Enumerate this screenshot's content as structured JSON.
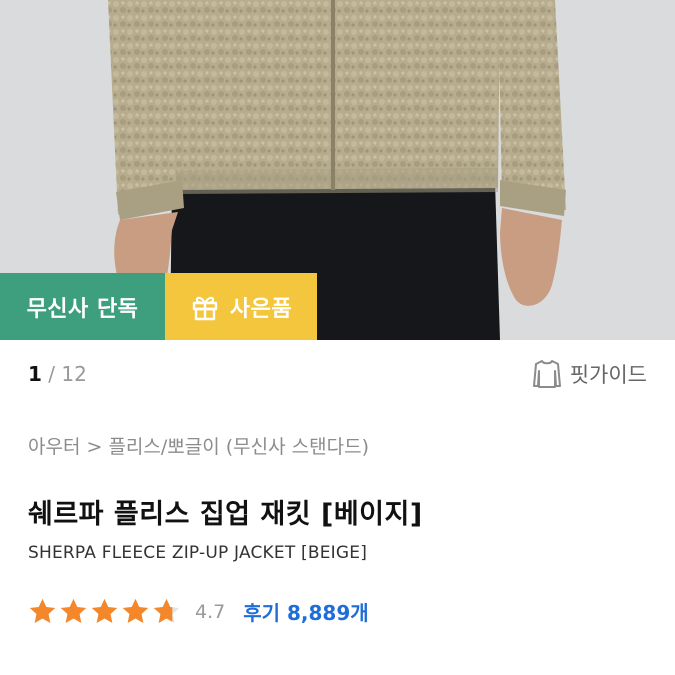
{
  "badges": {
    "exclusive": "무신사 단독",
    "gift": "사은품",
    "gift_icon": "gift-icon",
    "exclusive_color": "#3d9f7e",
    "gift_color": "#f4c63d"
  },
  "pager": {
    "current": "1",
    "separator": " / ",
    "total": "12"
  },
  "fit_guide": {
    "label": "핏가이드",
    "icon": "sweater-icon"
  },
  "breadcrumb": "아우터 > 플리스/뽀글이 (무신사 스탠다드)",
  "product": {
    "name_ko": "쉐르파 플리스 집업 재킷 [베이지]",
    "name_en": "SHERPA FLEECE ZIP-UP JACKET [BEIGE]"
  },
  "rating": {
    "score": "4.7",
    "stars_filled": 4.7,
    "stars_total": 5,
    "star_color": "#f5872b",
    "reviews_label": "후기 8,889개",
    "reviews_color": "#1e6dd8"
  }
}
